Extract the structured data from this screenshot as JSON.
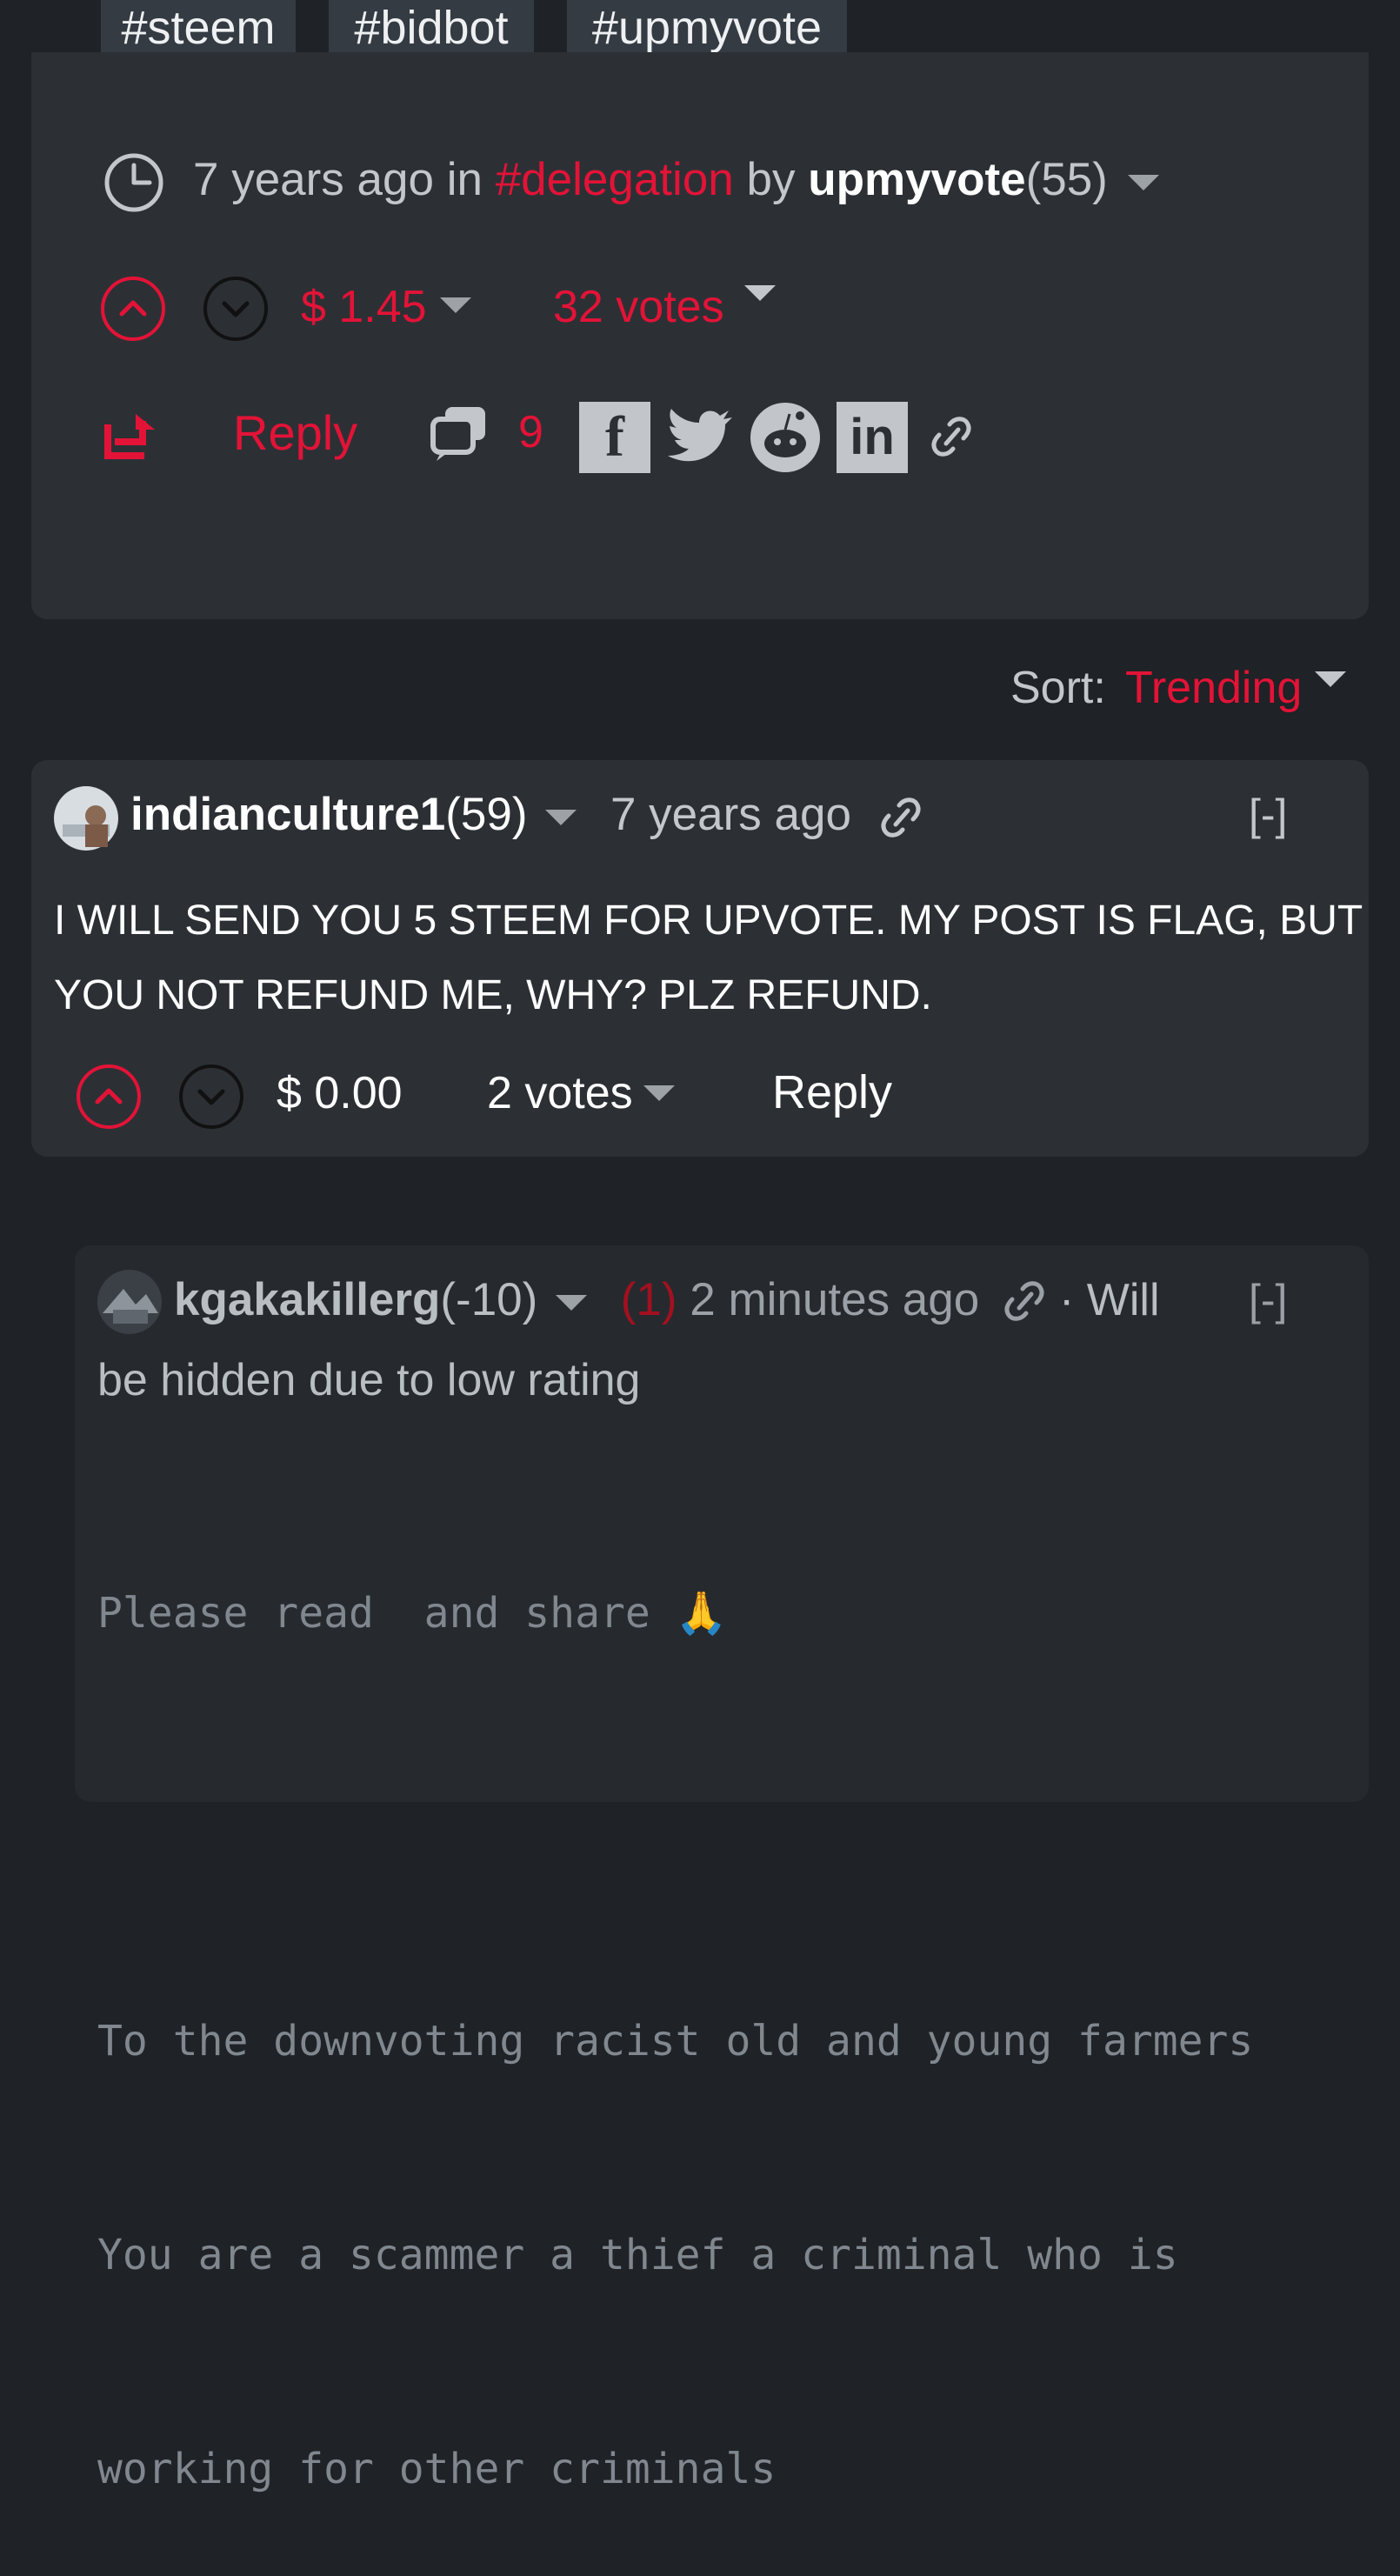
{
  "tags": [
    "#steem",
    "#bidbot",
    "#upmyvote"
  ],
  "post": {
    "time_ago": "7 years ago",
    "in_word": "in",
    "category": "#delegation",
    "by_word": "by",
    "author": "upmyvote",
    "reputation": "(55)",
    "payout": "$ 1.45",
    "votes": "32 votes",
    "reply_label": "Reply",
    "comment_count": "9"
  },
  "sort": {
    "label": "Sort:",
    "value": "Trending"
  },
  "comments": [
    {
      "author": "indianculture1",
      "reputation": "(59)",
      "time_ago": "7 years ago",
      "collapse": "[-]",
      "body_line1": "I WILL SEND YOU 5 STEEM FOR UPVOTE. MY POST IS FLAG, BUT",
      "body_line2": "YOU NOT REFUND ME, WHY? PLZ REFUND.",
      "payout": "$ 0.00",
      "votes": "2 votes",
      "reply_label": "Reply"
    },
    {
      "author": "kgakakillerg",
      "reputation": "(-10)",
      "flag_count": "(1)",
      "time_ago": "2 minutes ago",
      "hidden_note_1": "· Will",
      "hidden_note_2": "be hidden due to low rating",
      "collapse": "[-]",
      "body_line1": "Please read  and share 🙏",
      "body_line2": "To the downvoting racist old and young farmers",
      "body_line3": "You are a scammer a thief a criminal who is",
      "body_line4": "working for other criminals"
    }
  ],
  "colors": {
    "background": "#1f2226",
    "card": "#2c3035",
    "accent_red": "#e31337",
    "text_light": "#d7dadd"
  },
  "icons": [
    "clock-icon",
    "upvote-icon",
    "downvote-icon",
    "resteem-icon",
    "comments-icon",
    "facebook-icon",
    "twitter-icon",
    "reddit-icon",
    "linkedin-icon",
    "link-icon"
  ]
}
